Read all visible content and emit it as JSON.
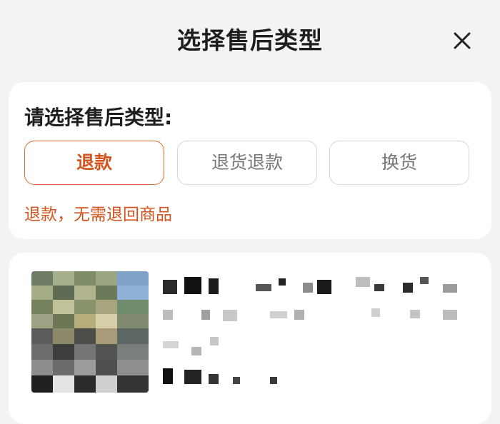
{
  "header": {
    "title": "选择售后类型",
    "close_icon": "close-icon"
  },
  "service_type": {
    "label": "请选择售后类型:",
    "options": [
      {
        "label": "退款",
        "selected": true
      },
      {
        "label": "退货退款",
        "selected": false
      },
      {
        "label": "换货",
        "selected": false
      }
    ],
    "hint": "退款，无需退回商品"
  },
  "colors": {
    "accent": "#d3541e",
    "selected_border": "#d86a2a",
    "background": "#f3f3f3",
    "card": "#ffffff"
  }
}
